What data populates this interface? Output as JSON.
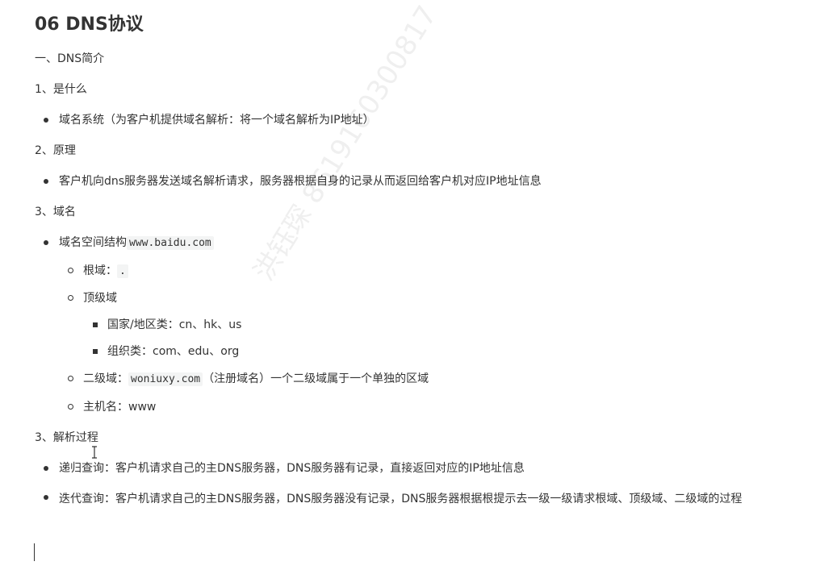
{
  "title": "06 DNS协议",
  "watermark": "洪钰琛 8619160300817",
  "sections": {
    "s1": "一、DNS简介",
    "s1_1": "1、是什么",
    "s1_1_b1": "域名系统（为客户机提供域名解析：将一个域名解析为IP地址）",
    "s1_2": "2、原理",
    "s1_2_b1": "客户机向dns服务器发送域名解析请求，服务器根据自身的记录从而返回给客户机对应IP地址信息",
    "s1_3": "3、域名",
    "s1_3_b1_text": "域名空间结构",
    "s1_3_b1_code": "www.baidu.com",
    "root_label": "根域：",
    "root_code": ".",
    "tld_label": "顶级域",
    "tld_country": "国家/地区类：cn、hk、us",
    "tld_org": "组织类：com、edu、org",
    "sld_label": "二级域：",
    "sld_code": "woniuxy.com",
    "sld_desc": "（注册域名）一个二级域属于一个单独的区域",
    "host_label": "主机名：www",
    "s1_4": "3、解析过程",
    "s1_4_b1": "递归查询：客户机请求自己的主DNS服务器，DNS服务器有记录，直接返回对应的IP地址信息",
    "s1_4_b2": "迭代查询：客户机请求自己的主DNS服务器，DNS服务器没有记录，DNS服务器根据根提示去一级一级请求根域、顶级域、二级域的过程"
  }
}
